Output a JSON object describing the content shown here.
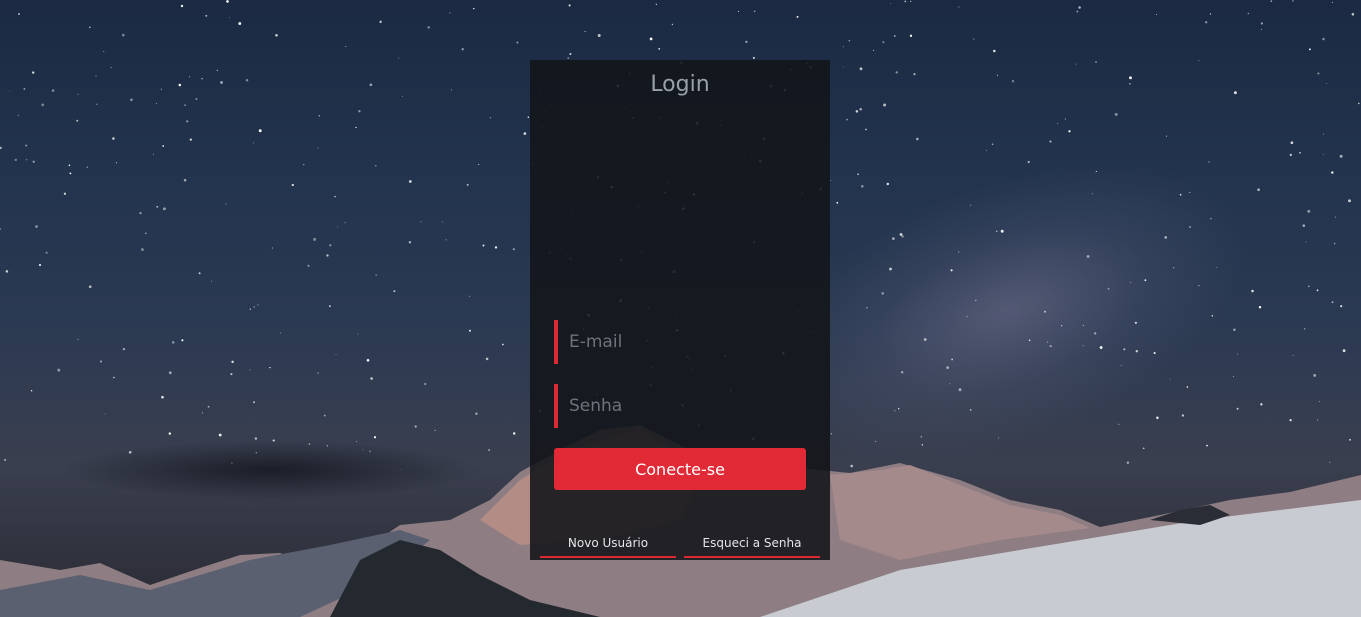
{
  "login": {
    "title": "Login",
    "email_placeholder": "E-mail",
    "password_placeholder": "Senha",
    "submit_label": "Conecte-se",
    "new_user_label": "Novo Usuário",
    "forgot_password_label": "Esqueci a Senha"
  },
  "colors": {
    "accent": "#dc2a35",
    "button": "#e12a36",
    "panel": "#121419"
  }
}
